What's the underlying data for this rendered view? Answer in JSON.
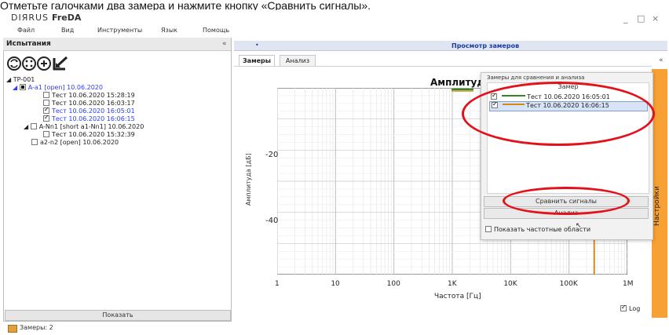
{
  "instruction_text": "Отметьте галочками два замера и нажмите кнопку «Сравнить сигналы».",
  "app": {
    "logo_text": "DIЯRUS",
    "title": "FreDA"
  },
  "window_controls": {
    "minimize": "_",
    "maximize": "□",
    "close": "×"
  },
  "menu": [
    "Файл",
    "Вид",
    "Инструменты",
    "Язык",
    "Помощь"
  ],
  "left_panel": {
    "title": "Испытания",
    "collapse_glyph": "«",
    "tree": [
      {
        "label": "TP-001",
        "level": 0,
        "expander": "◢",
        "checkbox": "none",
        "color": "normal"
      },
      {
        "label": "A-a1 [open] 10.06.2020",
        "level": 1,
        "expander": "◢",
        "checkbox": "filled",
        "color": "blue"
      },
      {
        "label": "Тест 10.06.2020 15:28:19",
        "level": 2,
        "checkbox": "unchecked",
        "color": "normal"
      },
      {
        "label": "Тест 10.06.2020 16:03:17",
        "level": 2,
        "checkbox": "unchecked",
        "color": "normal"
      },
      {
        "label": "Тест 10.06.2020 16:05:01",
        "level": 2,
        "checkbox": "checked",
        "color": "blue"
      },
      {
        "label": "Тест 10.06.2020 16:06:15",
        "level": 2,
        "checkbox": "checked",
        "color": "blue"
      },
      {
        "label": "A-Nn1 [short a1-Nn1] 10.06.2020",
        "level": 1,
        "expander": "◢",
        "checkbox": "unchecked",
        "color": "normal"
      },
      {
        "label": "Тест 10.06.2020 15:32:39",
        "level": 2,
        "checkbox": "unchecked",
        "color": "normal"
      },
      {
        "label": "a2-n2 [open] 10.06.2020",
        "level": 1,
        "checkbox": "unchecked",
        "color": "normal"
      }
    ],
    "show_button": "Показать"
  },
  "right_panel": {
    "title": "Просмотр замеров",
    "collapse_glyph": "«",
    "tabs": [
      "Замеры",
      "Анализ"
    ],
    "side_label": "Настройки"
  },
  "chart_data": {
    "type": "line",
    "title": "Амплитуд",
    "xlabel": "Частота [Гц]",
    "ylabel": "Амплитуда [дБ]",
    "x_scale": "log",
    "x_ticks": [
      "1",
      "10",
      "100",
      "1K",
      "10K",
      "100K",
      "1M"
    ],
    "y_ticks": [
      "-20",
      "-40"
    ],
    "xlim": [
      1,
      1000000
    ],
    "grid": true,
    "series": [
      {
        "name": "Тест 10.06.2020 16:05:01",
        "color": "#2e8b1f"
      },
      {
        "name": "Тест 10.06.2020 16:06:15",
        "color": "#d08a1a"
      }
    ]
  },
  "compare_popup": {
    "title": "Замеры для сравнения и анализа",
    "column_header": "Замер",
    "rows": [
      {
        "label": "Тест 10.06.2020 16:05:01",
        "checked": true,
        "color": "#2e8b1f"
      },
      {
        "label": "Тест 10.06.2020 16:06:15",
        "checked": true,
        "color": "#d08a1a"
      }
    ],
    "compare_button": "Сравнить сигналы",
    "analysis_button": "Анализ",
    "show_freq_label": "Показать частотные области"
  },
  "log_checkbox": {
    "label": "Log",
    "checked": true
  },
  "status": {
    "text": "Замеры: 2"
  },
  "colors": {
    "highlight": "#e2111a",
    "accent_side": "#f7a033",
    "header_blue": "#1a3aa8"
  }
}
